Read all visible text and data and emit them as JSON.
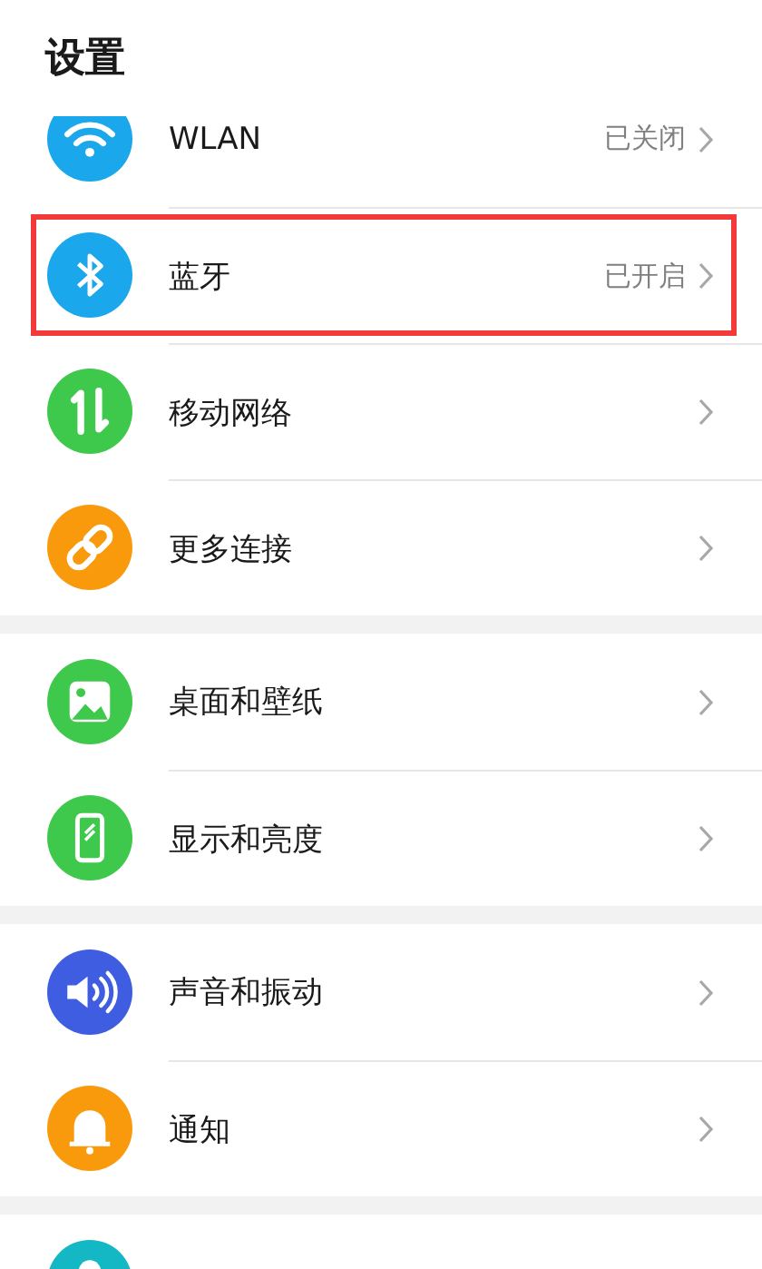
{
  "title": "设置",
  "groups": [
    {
      "items": [
        {
          "kind": "wifi",
          "color": "#1aa7ec",
          "label": "WLAN",
          "value": "已关闭",
          "highlighted": false
        },
        {
          "kind": "bluetooth",
          "color": "#1aa7ec",
          "label": "蓝牙",
          "value": "已开启",
          "highlighted": true
        },
        {
          "kind": "mobile-data",
          "color": "#3ec94c",
          "label": "移动网络",
          "highlighted": false
        },
        {
          "kind": "link",
          "color": "#f99a0c",
          "label": "更多连接",
          "highlighted": false
        }
      ]
    },
    {
      "items": [
        {
          "kind": "wallpaper",
          "color": "#3ec94c",
          "label": "桌面和壁纸",
          "highlighted": false
        },
        {
          "kind": "display",
          "color": "#3ec94c",
          "label": "显示和亮度",
          "highlighted": false
        }
      ]
    },
    {
      "items": [
        {
          "kind": "sound",
          "color": "#3f5de0",
          "label": "声音和振动",
          "highlighted": false
        },
        {
          "kind": "bell",
          "color": "#f99a0c",
          "label": "通知",
          "highlighted": false
        }
      ]
    },
    {
      "items": [
        {
          "kind": "generic",
          "color": "#14b8c4",
          "highlighted": false
        }
      ]
    }
  ]
}
